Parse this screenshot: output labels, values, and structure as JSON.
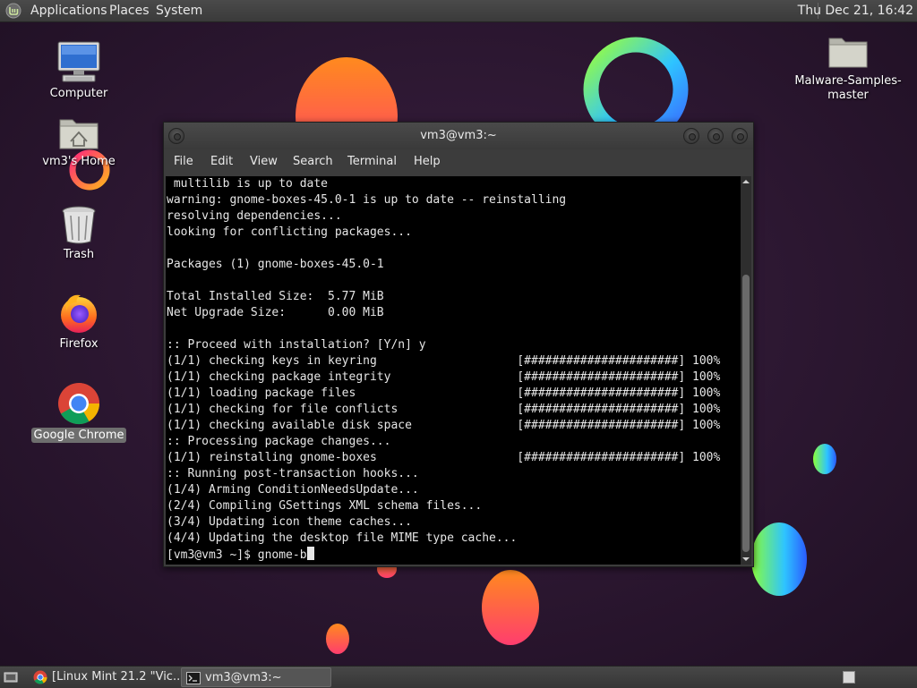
{
  "top_panel": {
    "menus": [
      "Applications",
      "Places",
      "System"
    ],
    "clock": "Thu Dec 21, 16:42"
  },
  "desktop": {
    "icons": [
      {
        "label": "Computer",
        "icon": "computer-icon"
      },
      {
        "label": "vm3's Home",
        "icon": "home-folder-icon"
      },
      {
        "label": "Trash",
        "icon": "trash-icon"
      },
      {
        "label": "Firefox",
        "icon": "firefox-icon"
      },
      {
        "label": "Google Chrome",
        "icon": "chrome-icon"
      },
      {
        "label": "Malware-Samples-\nmaster",
        "icon": "folder-icon"
      }
    ]
  },
  "terminal": {
    "title": "vm3@vm3:~",
    "menus": [
      "File",
      "Edit",
      "View",
      "Search",
      "Terminal",
      "Help"
    ],
    "lines": [
      " multilib is up to date",
      "warning: gnome-boxes-45.0-1 is up to date -- reinstalling",
      "resolving dependencies...",
      "looking for conflicting packages...",
      "",
      "Packages (1) gnome-boxes-45.0-1",
      "",
      "Total Installed Size:  5.77 MiB",
      "Net Upgrade Size:      0.00 MiB",
      "",
      ":: Proceed with installation? [Y/n] y",
      "(1/1) checking keys in keyring                    [######################] 100%",
      "(1/1) checking package integrity                  [######################] 100%",
      "(1/1) loading package files                       [######################] 100%",
      "(1/1) checking for file conflicts                 [######################] 100%",
      "(1/1) checking available disk space               [######################] 100%",
      ":: Processing package changes...",
      "(1/1) reinstalling gnome-boxes                    [######################] 100%",
      ":: Running post-transaction hooks...",
      "(1/4) Arming ConditionNeedsUpdate...",
      "(2/4) Compiling GSettings XML schema files...",
      "(3/4) Updating icon theme caches...",
      "(4/4) Updating the desktop file MIME type cache..."
    ],
    "prompt": "[vm3@vm3 ~]$ ",
    "input": "gnome-b"
  },
  "taskbar": {
    "tasks": [
      {
        "label": "[Linux Mint 21.2 \"Vic...",
        "icon": "chrome-icon"
      },
      {
        "label": "vm3@vm3:~",
        "icon": "terminal-icon"
      }
    ]
  }
}
